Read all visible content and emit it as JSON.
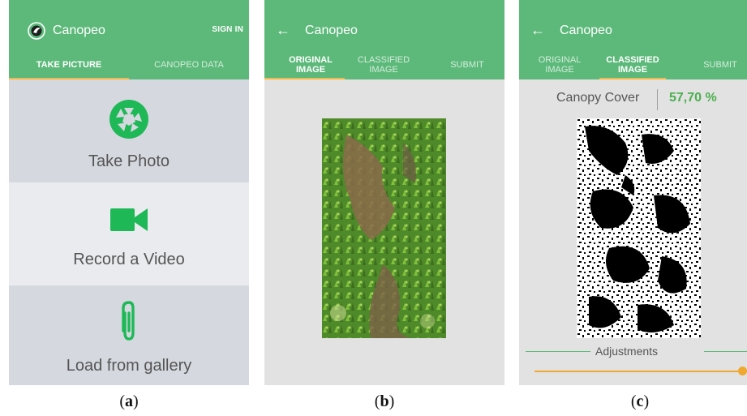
{
  "panel_a": {
    "title": "Canopeo",
    "sign_in": "SIGN IN",
    "tabs": [
      {
        "label": "TAKE PICTURE",
        "active": true
      },
      {
        "label": "CANOPEO DATA",
        "active": false
      }
    ],
    "tiles": [
      {
        "label": "Take Photo",
        "icon": "aperture-icon",
        "bg": "#d5d9df"
      },
      {
        "label": "Record a Video",
        "icon": "video-camera-icon",
        "bg": "#e9ebee"
      },
      {
        "label": "Load from gallery",
        "icon": "paperclip-icon",
        "bg": "#d5d9df"
      }
    ],
    "caption": "(a)"
  },
  "panel_b": {
    "title": "Canopeo",
    "tabs": [
      {
        "label": "ORIGINAL IMAGE",
        "active": true
      },
      {
        "label": "CLASSIFIED IMAGE",
        "active": false
      },
      {
        "label": "SUBMIT",
        "active": false
      }
    ],
    "caption": "(b)"
  },
  "panel_c": {
    "title": "Canopeo",
    "tabs": [
      {
        "label": "ORIGINAL IMAGE",
        "active": false
      },
      {
        "label": "CLASSIFIED IMAGE",
        "active": true
      },
      {
        "label": "SUBMIT",
        "active": false
      }
    ],
    "canopy_label": "Canopy Cover",
    "canopy_value": "57,70 %",
    "adjustments_label": "Adjustments",
    "slider_value": 1.0,
    "caption": "(c)"
  },
  "colors": {
    "app_green": "#5cb97a",
    "accent_orange": "#f0a830",
    "icon_green": "#1fb857",
    "canopy_value_green": "#4caf50"
  }
}
